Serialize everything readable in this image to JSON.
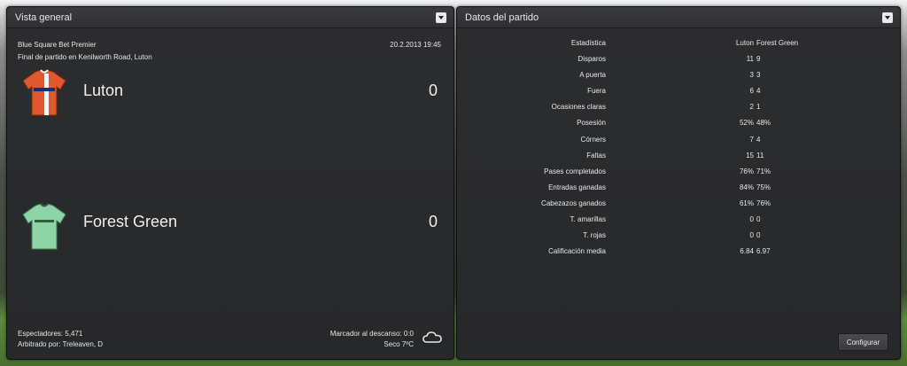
{
  "overview": {
    "title": "Vista general",
    "competition": "Blue Square Bet Premier",
    "datetime": "20.2.2013 19:45",
    "result_line": "Final de partido en Kenilworth Road, Luton",
    "home": {
      "name": "Luton",
      "score": "0",
      "shirt_icon": "luton-shirt-icon",
      "shirt_color": "#e0582e"
    },
    "away": {
      "name": "Forest Green",
      "score": "0",
      "shirt_icon": "forest-green-shirt-icon",
      "shirt_color": "#8fd4a6"
    },
    "attendance": "Espectadores: 5,471",
    "referee": "Arbitrado por: Treleaven, D",
    "halftime": "Marcador al descanso: 0:0",
    "weather": "Seco 7ºC",
    "weather_icon": "cloud-icon"
  },
  "match_data": {
    "title": "Datos del partido",
    "header": {
      "label": "Estadística",
      "home": "Luton",
      "away": "Forest Green"
    },
    "rows": [
      {
        "label": "Disparos",
        "home": "11",
        "away": "9"
      },
      {
        "label": "A puerta",
        "home": "3",
        "away": "3"
      },
      {
        "label": "Fuera",
        "home": "6",
        "away": "4"
      },
      {
        "label": "Ocasiones claras",
        "home": "2",
        "away": "1"
      },
      {
        "label": "Posesión",
        "home": "52%",
        "away": "48%"
      },
      {
        "label": "Córners",
        "home": "7",
        "away": "4"
      },
      {
        "label": "Faltas",
        "home": "15",
        "away": "11"
      },
      {
        "label": "Pases completados",
        "home": "76%",
        "away": "71%"
      },
      {
        "label": "Entradas ganadas",
        "home": "84%",
        "away": "75%"
      },
      {
        "label": "Cabezazos ganados",
        "home": "61%",
        "away": "76%"
      },
      {
        "label": "T. amarillas",
        "home": "0",
        "away": "0"
      },
      {
        "label": "T. rojas",
        "home": "0",
        "away": "0"
      },
      {
        "label": "Calificación media",
        "home": "6.84",
        "away": "6.97"
      }
    ],
    "configure_label": "Configurar"
  }
}
